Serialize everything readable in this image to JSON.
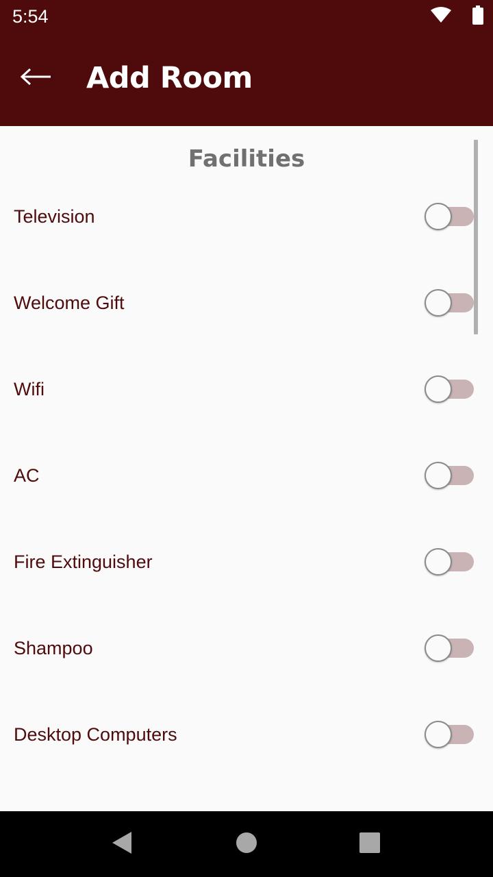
{
  "status_bar": {
    "time": "5:54",
    "icons": [
      "wifi-icon",
      "battery-icon"
    ]
  },
  "app_bar": {
    "title": "Add Room",
    "back_icon": "arrow-left-icon"
  },
  "section": {
    "title": "Facilities"
  },
  "facilities": [
    {
      "label": "Television",
      "enabled": false
    },
    {
      "label": "Welcome Gift",
      "enabled": false
    },
    {
      "label": "Wifi",
      "enabled": false
    },
    {
      "label": "AC",
      "enabled": false
    },
    {
      "label": "Fire Extinguisher",
      "enabled": false
    },
    {
      "label": "Shampoo",
      "enabled": false
    },
    {
      "label": "Desktop Computers",
      "enabled": false
    }
  ],
  "nav_bar": {
    "buttons": [
      "back-triangle-icon",
      "home-circle-icon",
      "recents-square-icon"
    ]
  },
  "colors": {
    "primary": "#4f0a0c",
    "background": "#fafafa",
    "section_title": "#707070",
    "switch_track_off": "#c9b3b4"
  }
}
